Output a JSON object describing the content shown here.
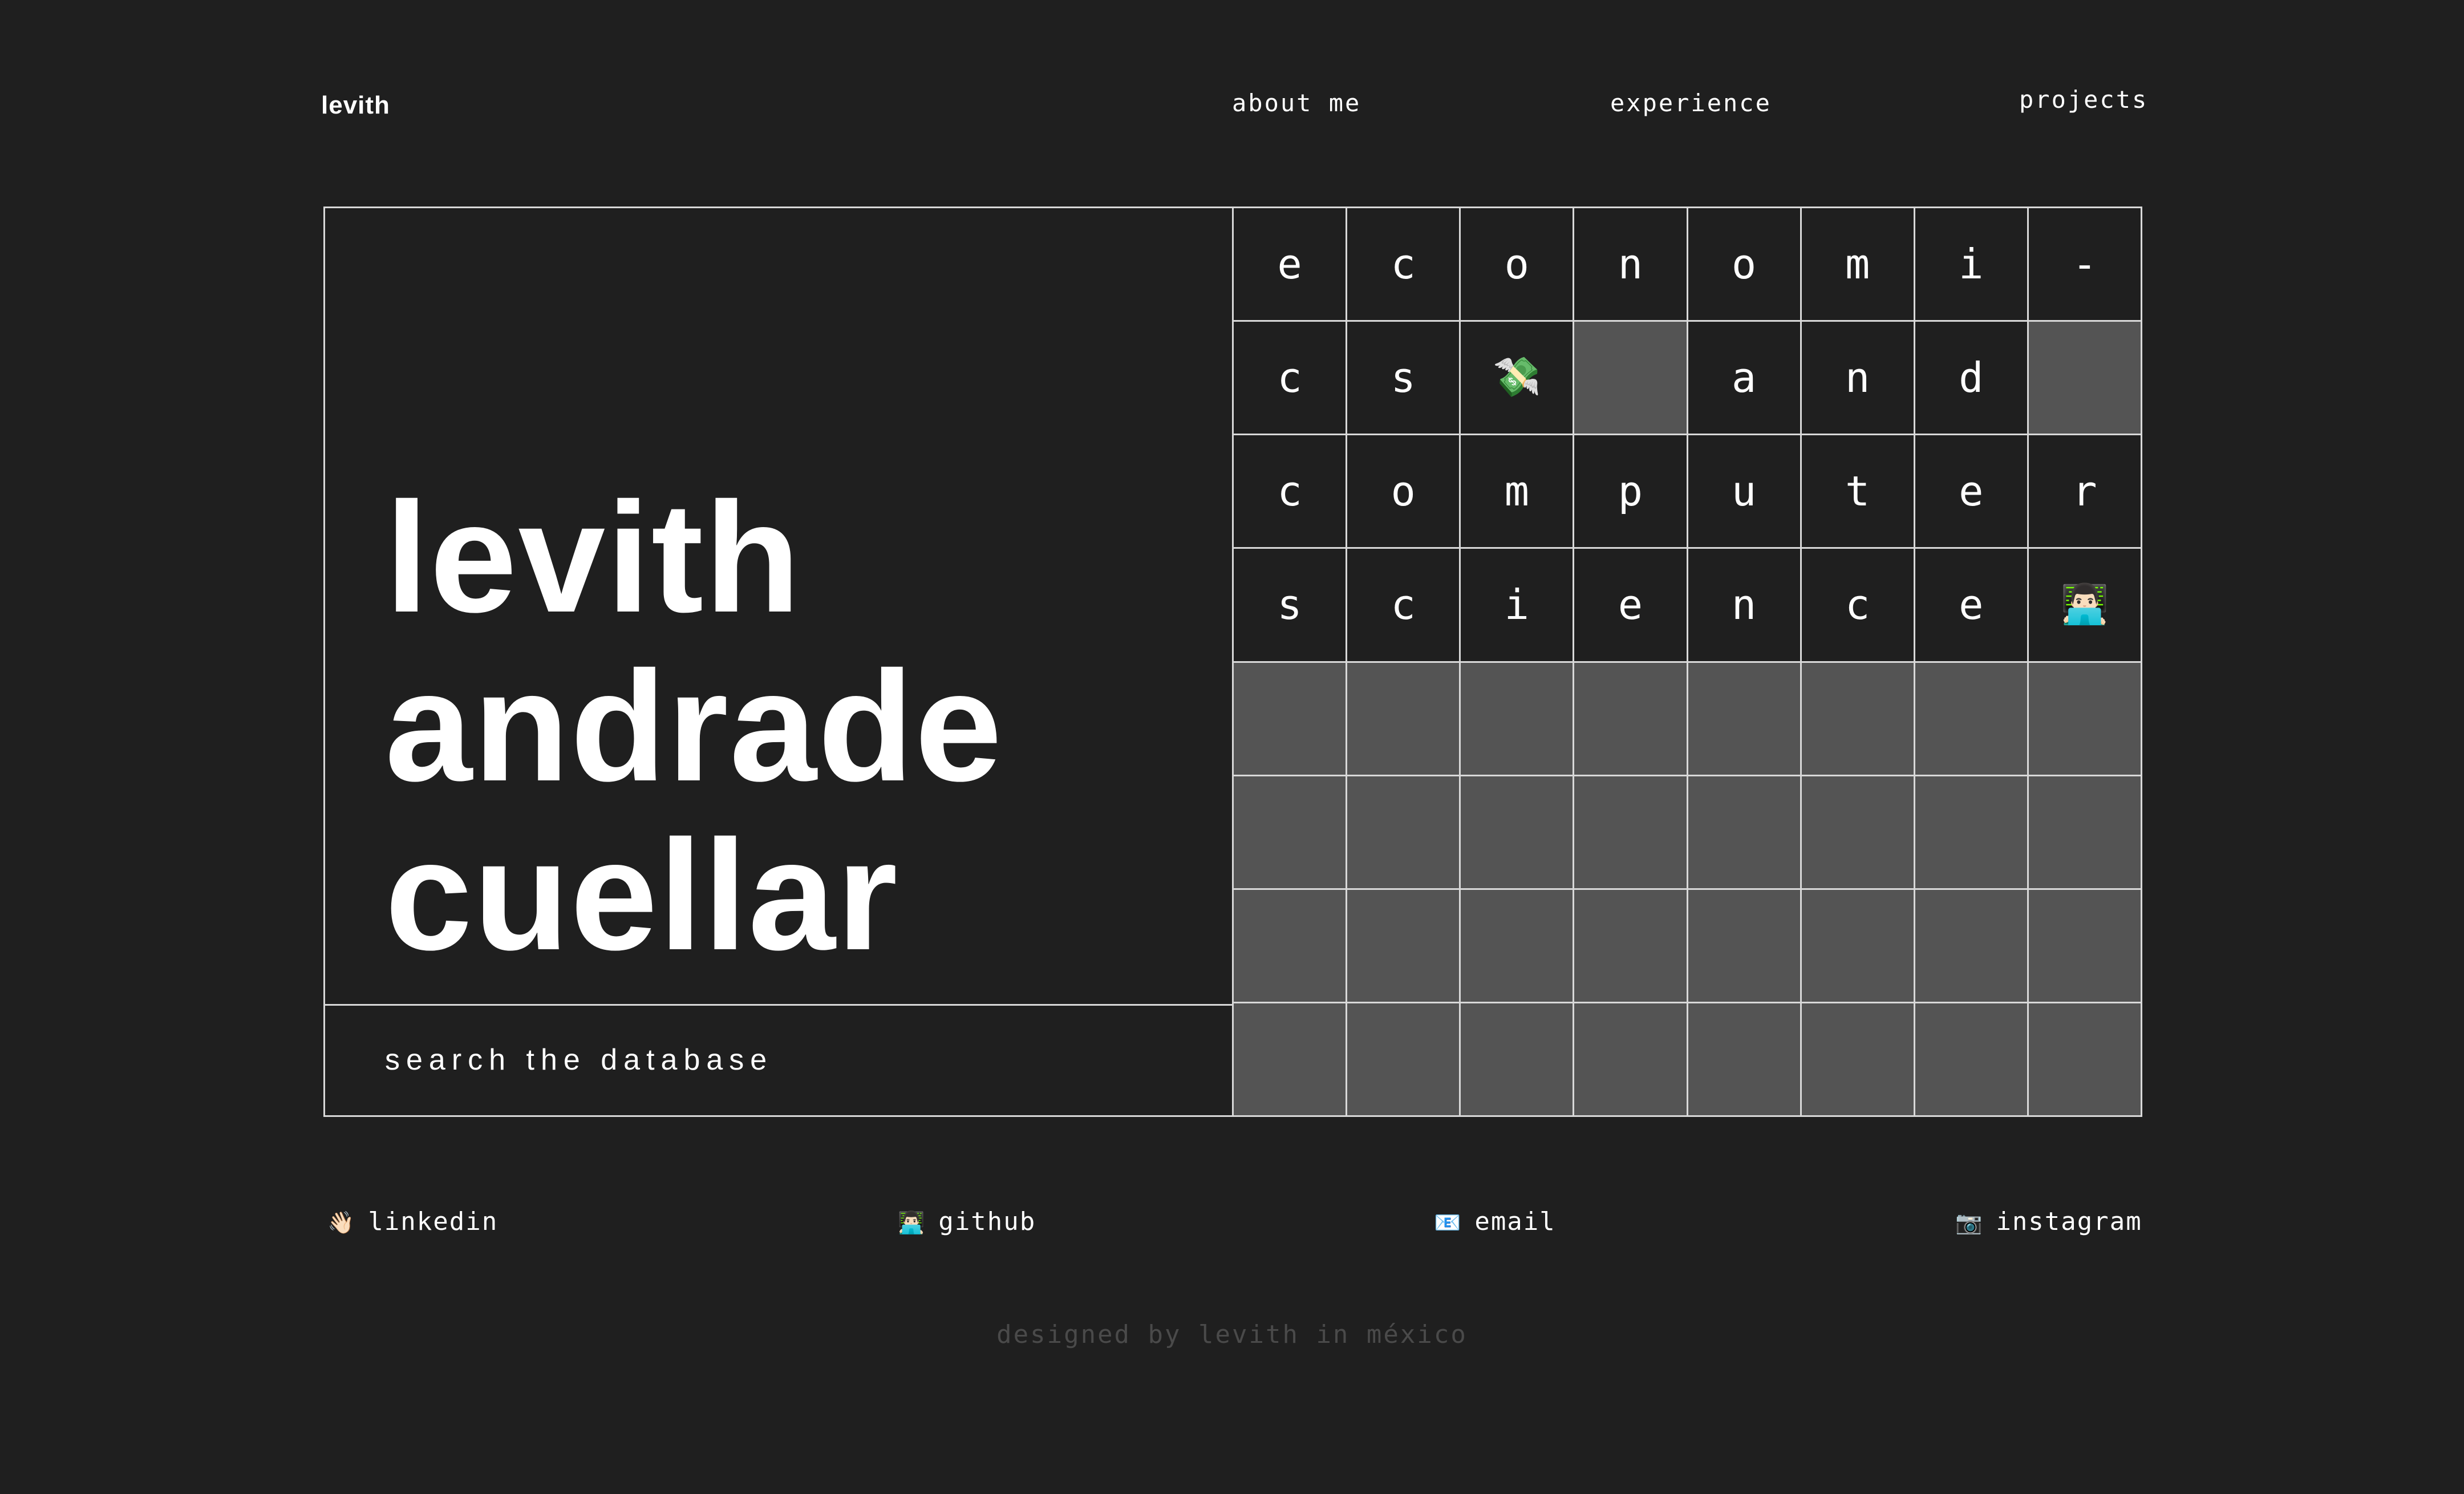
{
  "header": {
    "logo": "levith",
    "nav": {
      "about": "about me",
      "experience": "experience",
      "projects": "projects"
    }
  },
  "hero": {
    "name_lines": [
      "levith",
      "andrade",
      "cuellar"
    ],
    "search_label": "search the database"
  },
  "grid": {
    "cells": [
      "e",
      "c",
      "o",
      "n",
      "o",
      "m",
      "i",
      "-",
      "c",
      "s",
      "💸",
      "",
      "a",
      "n",
      "d",
      "",
      "c",
      "o",
      "m",
      "p",
      "u",
      "t",
      "e",
      "r",
      "s",
      "c",
      "i",
      "e",
      "n",
      "c",
      "e",
      "👨🏻‍💻",
      "",
      "",
      "",
      "",
      "",
      "",
      "",
      "",
      "",
      "",
      "",
      "",
      "",
      "",
      "",
      "",
      "",
      "",
      "",
      "",
      "",
      "",
      "",
      "",
      "",
      "",
      "",
      "",
      "",
      "",
      "",
      ""
    ]
  },
  "socials": {
    "linkedin": {
      "icon": "👋🏻",
      "label": "linkedin"
    },
    "github": {
      "icon": "👨🏻‍💻",
      "label": "github"
    },
    "email": {
      "icon": "📧",
      "label": "email"
    },
    "instagram": {
      "icon": "📷",
      "label": "instagram"
    }
  },
  "footer": {
    "text": "designed by levith in méxico"
  },
  "colors": {
    "background": "#1f1f1f",
    "empty_cell": "#545454",
    "border": "#d8d8d8",
    "footer_text": "#4a4a4a"
  }
}
